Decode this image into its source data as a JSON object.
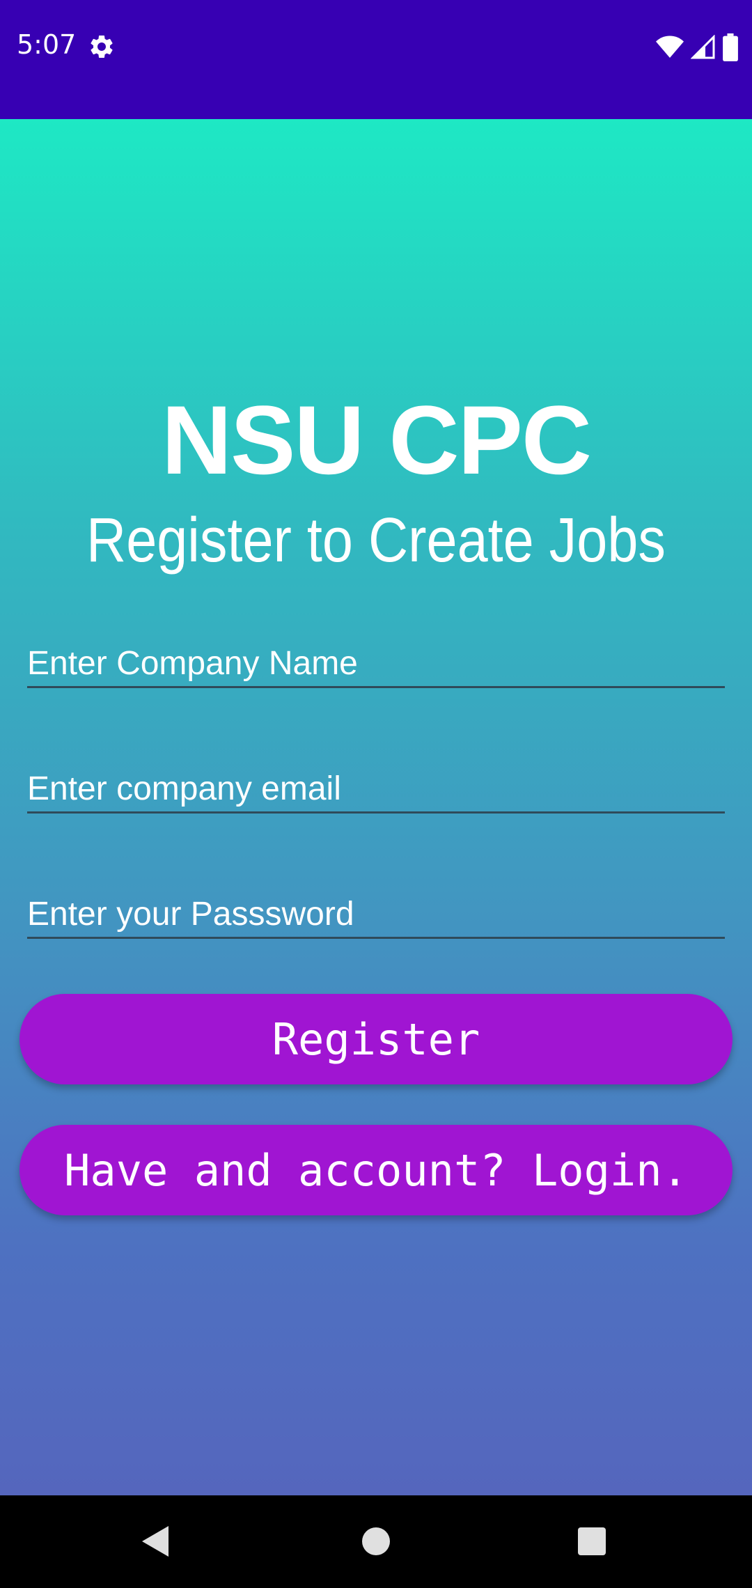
{
  "status_bar": {
    "time": "5:07",
    "icons": [
      "gear-icon",
      "wifi-icon",
      "signal-icon",
      "battery-icon"
    ],
    "background": "#3700b3"
  },
  "header": {
    "title": "NSU CPC",
    "subtitle": "Register to Create Jobs"
  },
  "form": {
    "company_name_placeholder": "Enter Company Name",
    "company_email_placeholder": "Enter company email",
    "password_placeholder": "Enter your Passsword"
  },
  "buttons": {
    "register_label": "Register",
    "login_label": "Have and account? Login.",
    "color": "#a015d2"
  },
  "nav_bar": {
    "icons": [
      "back-icon",
      "home-icon",
      "recents-icon"
    ]
  }
}
